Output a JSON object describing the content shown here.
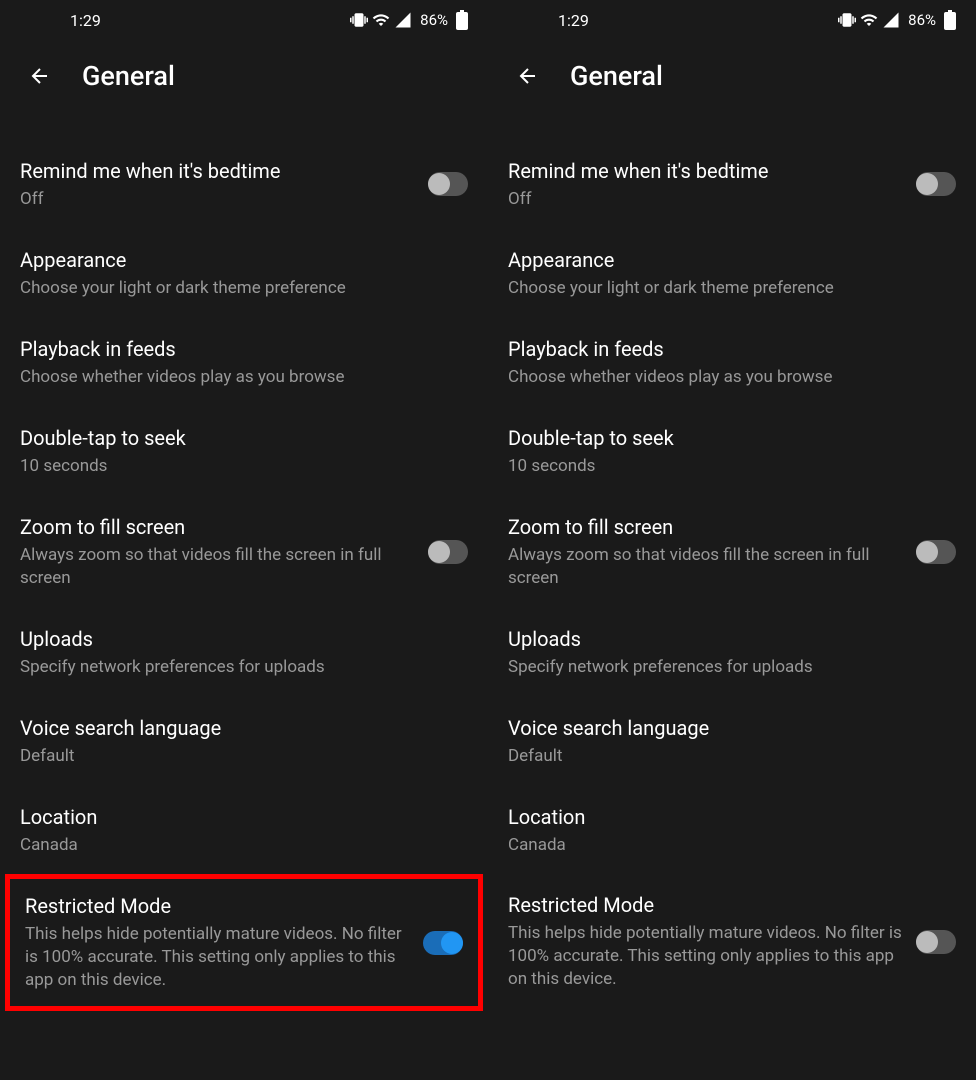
{
  "statusBar": {
    "time": "1:29",
    "batteryPercent": "86%"
  },
  "header": {
    "title": "General"
  },
  "settings": {
    "bedtime": {
      "title": "Remind me when it's bedtime",
      "subtitle": "Off"
    },
    "appearance": {
      "title": "Appearance",
      "subtitle": "Choose your light or dark theme preference"
    },
    "playback": {
      "title": "Playback in feeds",
      "subtitle": "Choose whether videos play as you browse"
    },
    "doubleTap": {
      "title": "Double-tap to seek",
      "subtitle": "10 seconds"
    },
    "zoom": {
      "title": "Zoom to fill screen",
      "subtitle": "Always zoom so that videos fill the screen in full screen"
    },
    "uploads": {
      "title": "Uploads",
      "subtitle": "Specify network preferences for uploads"
    },
    "voiceSearch": {
      "title": "Voice search language",
      "subtitle": "Default"
    },
    "location": {
      "title": "Location",
      "subtitle": "Canada"
    },
    "restrictedMode": {
      "title": "Restricted Mode",
      "subtitle": "This helps hide potentially mature videos. No filter is 100% accurate. This setting only applies to this app on this device."
    }
  },
  "screens": {
    "left": {
      "restrictedModeHighlighted": true,
      "restrictedModeOn": true
    },
    "right": {
      "restrictedModeHighlighted": false,
      "restrictedModeOn": false
    }
  }
}
